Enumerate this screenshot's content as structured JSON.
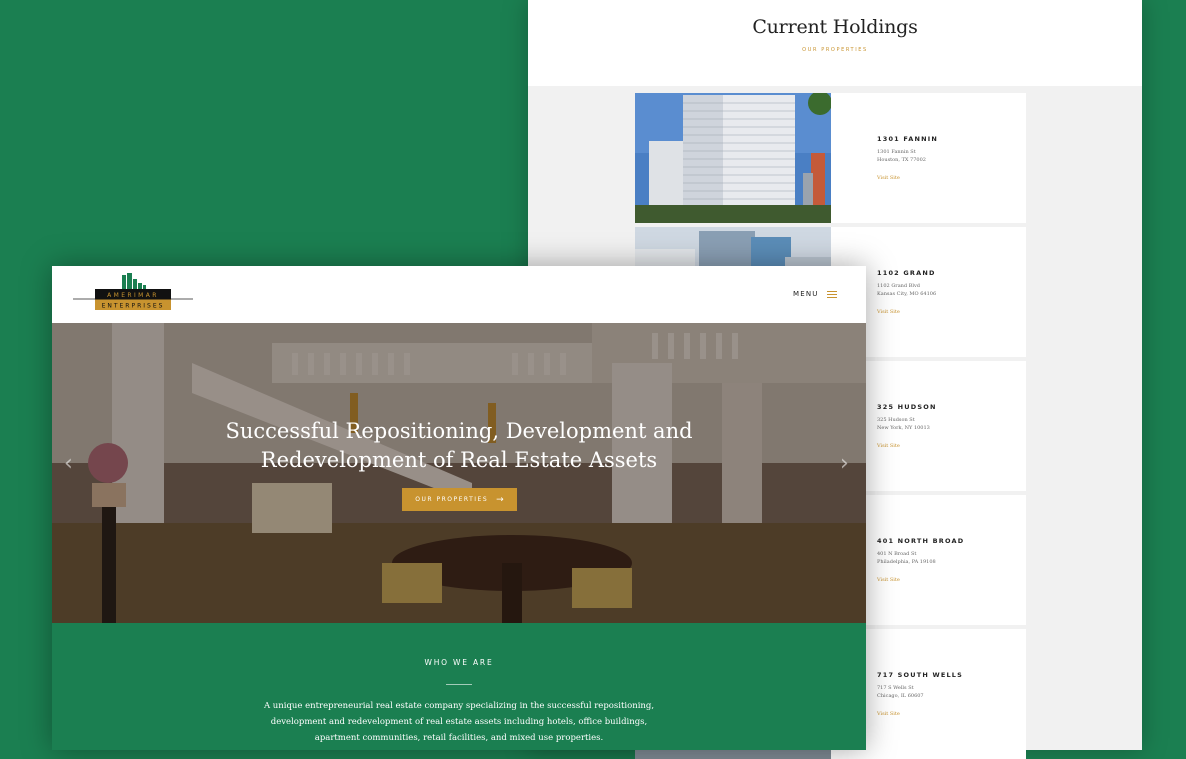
{
  "holdings_page": {
    "title": "Current Holdings",
    "subtitle": "OUR PROPERTIES",
    "properties": [
      {
        "name": "1301 FANNIN",
        "address_line1": "1301 Fannin St",
        "address_line2": "Houston, TX 77002",
        "link": "Visit Site"
      },
      {
        "name": "1102 GRAND",
        "address_line1": "1102 Grand Blvd",
        "address_line2": "Kansas City, MO 64106",
        "link": "Visit Site"
      },
      {
        "name": "325 HUDSON",
        "address_line1": "325 Hudson St",
        "address_line2": "New York, NY 10013",
        "link": "Visit Site"
      },
      {
        "name": "401 NORTH BROAD",
        "address_line1": "401 N Broad St",
        "address_line2": "Philadelphia, PA 19108",
        "link": "Visit Site"
      },
      {
        "name": "717 SOUTH WELLS",
        "address_line1": "717 S Wells St",
        "address_line2": "Chicago, IL 60607",
        "link": "Visit Site"
      }
    ]
  },
  "home_page": {
    "logo": {
      "line1": "AMERIMAR",
      "line2": "ENTERPRISES"
    },
    "menu_label": "MENU",
    "hero": {
      "title": "Successful Repositioning, Development and\nRedevelopment of Real Estate Assets",
      "cta_label": "OUR PROPERTIES",
      "cta_icon": "arrow-right-icon"
    },
    "who_we_are": {
      "title": "WHO WE ARE",
      "text": "A unique entrepreneurial real estate company specializing in the successful repositioning,\ndevelopment and redevelopment of real estate assets including hotels, office buildings,\napartment communities, retail facilities, and mixed use properties."
    }
  },
  "colors": {
    "background_green": "#1b7f51",
    "accent_gold": "#c8932f"
  }
}
